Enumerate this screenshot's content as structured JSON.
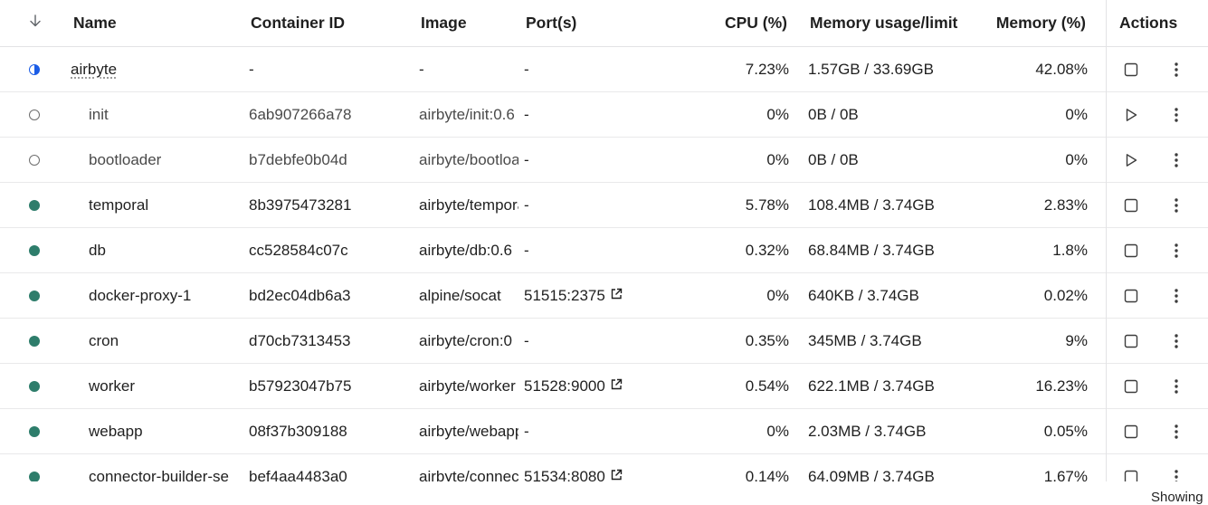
{
  "table": {
    "headers": {
      "sort_icon": "arrow-down-icon",
      "name": "Name",
      "container_id": "Container ID",
      "image": "Image",
      "ports": "Port(s)",
      "cpu": "CPU (%)",
      "memory_usage": "Memory usage/limit",
      "memory_percent": "Memory (%)",
      "actions": "Actions"
    },
    "rows": [
      {
        "status": "partial",
        "name": "airbyte",
        "container_id": "-",
        "image": "-",
        "ports": "-",
        "port_link": false,
        "cpu": "7.23%",
        "memory_usage": "1.57GB / 33.69GB",
        "memory_percent": "42.08%",
        "action": "stop"
      },
      {
        "status": "exited",
        "name": "init",
        "container_id": "6ab907266a78",
        "image": "airbyte/init:0.6",
        "ports": "-",
        "port_link": false,
        "cpu": "0%",
        "memory_usage": "0B / 0B",
        "memory_percent": "0%",
        "action": "start"
      },
      {
        "status": "exited",
        "name": "bootloader",
        "container_id": "b7debfe0b04d",
        "image": "airbyte/bootloader",
        "ports": "-",
        "port_link": false,
        "cpu": "0%",
        "memory_usage": "0B / 0B",
        "memory_percent": "0%",
        "action": "start"
      },
      {
        "status": "running",
        "name": "temporal",
        "container_id": "8b3975473281",
        "image": "airbyte/temporal",
        "ports": "-",
        "port_link": false,
        "cpu": "5.78%",
        "memory_usage": "108.4MB / 3.74GB",
        "memory_percent": "2.83%",
        "action": "stop"
      },
      {
        "status": "running",
        "name": "db",
        "container_id": "cc528584c07c",
        "image": "airbyte/db:0.6",
        "ports": "-",
        "port_link": false,
        "cpu": "0.32%",
        "memory_usage": "68.84MB / 3.74GB",
        "memory_percent": "1.8%",
        "action": "stop"
      },
      {
        "status": "running",
        "name": "docker-proxy-1",
        "container_id": "bd2ec04db6a3",
        "image": "alpine/socat",
        "ports": "51515:2375",
        "port_link": true,
        "cpu": "0%",
        "memory_usage": "640KB / 3.74GB",
        "memory_percent": "0.02%",
        "action": "stop"
      },
      {
        "status": "running",
        "name": "cron",
        "container_id": "d70cb7313453",
        "image": "airbyte/cron:0",
        "ports": "-",
        "port_link": false,
        "cpu": "0.35%",
        "memory_usage": "345MB / 3.74GB",
        "memory_percent": "9%",
        "action": "stop"
      },
      {
        "status": "running",
        "name": "worker",
        "container_id": "b57923047b75",
        "image": "airbyte/worker",
        "ports": "51528:9000",
        "port_link": true,
        "cpu": "0.54%",
        "memory_usage": "622.1MB / 3.74GB",
        "memory_percent": "16.23%",
        "action": "stop"
      },
      {
        "status": "running",
        "name": "webapp",
        "container_id": "08f37b309188",
        "image": "airbyte/webapp",
        "ports": "-",
        "port_link": false,
        "cpu": "0%",
        "memory_usage": "2.03MB / 3.74GB",
        "memory_percent": "0.05%",
        "action": "stop"
      },
      {
        "status": "running",
        "name": "connector-builder-se",
        "container_id": "bef4aa4483a0",
        "image": "airbyte/connector",
        "ports": "51534:8080",
        "port_link": true,
        "cpu": "0.14%",
        "memory_usage": "64.09MB / 3.74GB",
        "memory_percent": "1.67%",
        "action": "stop"
      }
    ]
  },
  "footer": {
    "text": "Showing"
  },
  "colors": {
    "running": "#2e7d6b",
    "partial": "#1a5ce6",
    "exited_border": "#6e6e6e",
    "divider": "#e3e3e5"
  }
}
